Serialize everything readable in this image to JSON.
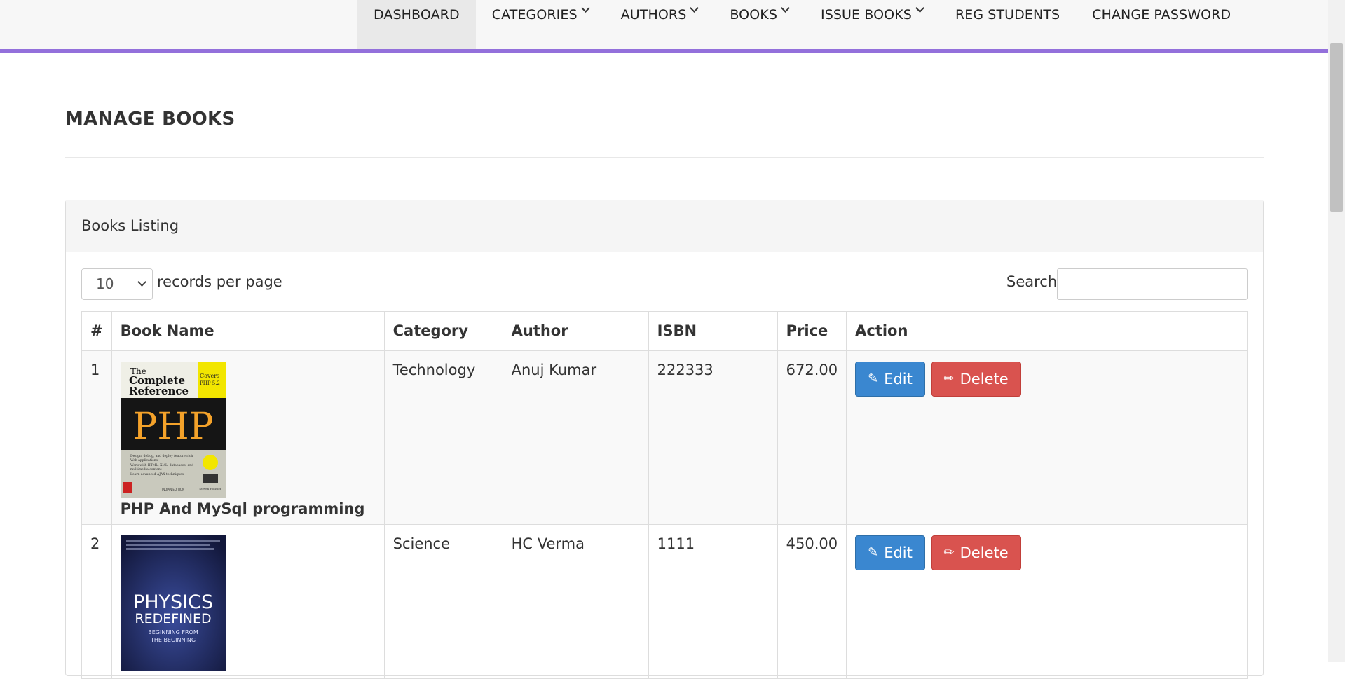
{
  "nav": {
    "items": [
      {
        "label": "DASHBOARD",
        "dropdown": false,
        "active": true
      },
      {
        "label": "CATEGORIES",
        "dropdown": true,
        "active": false
      },
      {
        "label": "AUTHORS",
        "dropdown": true,
        "active": false
      },
      {
        "label": "BOOKS",
        "dropdown": true,
        "active": false
      },
      {
        "label": "ISSUE BOOKS",
        "dropdown": true,
        "active": false
      },
      {
        "label": "REG STUDENTS",
        "dropdown": false,
        "active": false
      },
      {
        "label": "CHANGE PASSWORD",
        "dropdown": false,
        "active": false
      }
    ],
    "accent_color": "#9370db"
  },
  "page": {
    "title": "MANAGE BOOKS"
  },
  "panel": {
    "heading": "Books Listing",
    "length_value": "10",
    "length_label": "records per page",
    "search_label": "Search:",
    "search_value": ""
  },
  "table": {
    "columns": [
      "#",
      "Book Name",
      "Category",
      "Author",
      "ISBN",
      "Price",
      "Action"
    ],
    "rows": [
      {
        "num": "1",
        "book_name": "PHP And MySql programming",
        "category": "Technology",
        "author": "Anuj Kumar",
        "isbn": "222333",
        "price": "672.00",
        "cover_text": {
          "line1": "The",
          "line2": "Complete",
          "line3": "Reference",
          "big": "PHP",
          "tag1": "Covers",
          "tag2": "PHP 5.2",
          "edition": "INDIAN EDITION",
          "author_mark": "Steven Holzner",
          "bullet1": "Design, debug, and deploy feature-rich",
          "bullet1b": "Web applications",
          "bullet2": "Work with HTML, XML, databases, and",
          "bullet2b": "multimedia content",
          "bullet3": "Learn advanced AJAX techniques"
        }
      },
      {
        "num": "2",
        "book_name": "",
        "category": "Science",
        "author": "HC Verma",
        "isbn": "1111",
        "price": "450.00",
        "cover_text": {
          "line1": "PHYSICS",
          "line2": "REDEFINED",
          "line3": "BEGINNING FROM",
          "line4": "THE BEGINNING"
        }
      }
    ],
    "edit_label": "Edit",
    "delete_label": "Delete",
    "edit_icon": "edit-icon",
    "delete_icon": "pencil-icon",
    "edit_color": "#3a87d0",
    "delete_color": "#d9534f"
  }
}
